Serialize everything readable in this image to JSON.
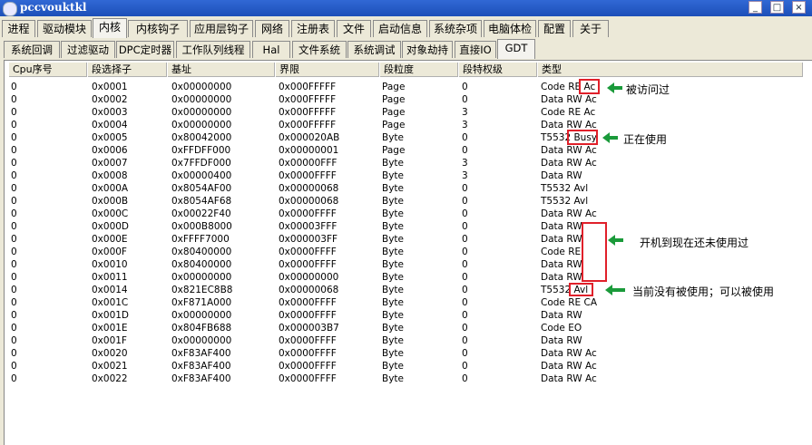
{
  "window": {
    "title": "pccvouktkl"
  },
  "tabs_main": [
    "进程",
    "驱动模块",
    "内核",
    "内核钩子",
    "应用层钩子",
    "网络",
    "注册表",
    "文件",
    "启动信息",
    "系统杂项",
    "电脑体检",
    "配置",
    "关于"
  ],
  "tabs_sub": [
    "系统回调",
    "过滤驱动",
    "DPC定时器",
    "工作队列线程",
    "Hal",
    "文件系统",
    "系统调试",
    "对象劫持",
    "直接IO",
    "GDT"
  ],
  "columns": [
    "Cpu序号",
    "段选择子",
    "基址",
    "界限",
    "段粒度",
    "段特权级",
    "类型"
  ],
  "rows": [
    [
      "0",
      "0x0001",
      "0x00000000",
      "0x000FFFFF",
      "Page",
      "0",
      "Code RE Ac"
    ],
    [
      "0",
      "0x0002",
      "0x00000000",
      "0x000FFFFF",
      "Page",
      "0",
      "Data RW Ac"
    ],
    [
      "0",
      "0x0003",
      "0x00000000",
      "0x000FFFFF",
      "Page",
      "3",
      "Code RE Ac"
    ],
    [
      "0",
      "0x0004",
      "0x00000000",
      "0x000FFFFF",
      "Page",
      "3",
      "Data RW Ac"
    ],
    [
      "0",
      "0x0005",
      "0x80042000",
      "0x000020AB",
      "Byte",
      "0",
      "T5532 Busy"
    ],
    [
      "0",
      "0x0006",
      "0xFFDFF000",
      "0x00000001",
      "Page",
      "0",
      "Data RW Ac"
    ],
    [
      "0",
      "0x0007",
      "0x7FFDF000",
      "0x00000FFF",
      "Byte",
      "3",
      "Data RW Ac"
    ],
    [
      "0",
      "0x0008",
      "0x00000400",
      "0x0000FFFF",
      "Byte",
      "3",
      "Data RW"
    ],
    [
      "0",
      "0x000A",
      "0x8054AF00",
      "0x00000068",
      "Byte",
      "0",
      "T5532 Avl"
    ],
    [
      "0",
      "0x000B",
      "0x8054AF68",
      "0x00000068",
      "Byte",
      "0",
      "T5532 Avl"
    ],
    [
      "0",
      "0x000C",
      "0x00022F40",
      "0x0000FFFF",
      "Byte",
      "0",
      "Data RW Ac"
    ],
    [
      "0",
      "0x000D",
      "0x000B8000",
      "0x00003FFF",
      "Byte",
      "0",
      "Data RW"
    ],
    [
      "0",
      "0x000E",
      "0xFFFF7000",
      "0x000003FF",
      "Byte",
      "0",
      "Data RW"
    ],
    [
      "0",
      "0x000F",
      "0x80400000",
      "0x0000FFFF",
      "Byte",
      "0",
      "Code RE"
    ],
    [
      "0",
      "0x0010",
      "0x80400000",
      "0x0000FFFF",
      "Byte",
      "0",
      "Data RW"
    ],
    [
      "0",
      "0x0011",
      "0x00000000",
      "0x00000000",
      "Byte",
      "0",
      "Data RW"
    ],
    [
      "0",
      "0x0014",
      "0x821EC8B8",
      "0x00000068",
      "Byte",
      "0",
      "T5532 Avl"
    ],
    [
      "0",
      "0x001C",
      "0xF871A000",
      "0x0000FFFF",
      "Byte",
      "0",
      "Code RE CA"
    ],
    [
      "0",
      "0x001D",
      "0x00000000",
      "0x0000FFFF",
      "Byte",
      "0",
      "Data RW"
    ],
    [
      "0",
      "0x001E",
      "0x804FB688",
      "0x000003B7",
      "Byte",
      "0",
      "Code EO"
    ],
    [
      "0",
      "0x001F",
      "0x00000000",
      "0x0000FFFF",
      "Byte",
      "0",
      "Data RW"
    ],
    [
      "0",
      "0x0020",
      "0xF83AF400",
      "0x0000FFFF",
      "Byte",
      "0",
      "Data RW Ac"
    ],
    [
      "0",
      "0x0021",
      "0xF83AF400",
      "0x0000FFFF",
      "Byte",
      "0",
      "Data RW Ac"
    ],
    [
      "0",
      "0x0022",
      "0xF83AF400",
      "0x0000FFFF",
      "Byte",
      "0",
      "Data RW Ac"
    ]
  ],
  "annotations": {
    "accessed": "被访问过",
    "in_use": "正在使用",
    "unused_since_boot": "开机到现在还未使用过",
    "available": "当前没有被使用；可以被使用"
  },
  "colors": {
    "annotation_box": "#e0202a",
    "arrow": "#1a9a3a"
  }
}
